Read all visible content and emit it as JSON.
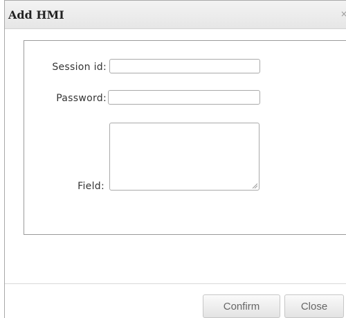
{
  "dialog": {
    "title": "Add HMI",
    "close_glyph": "×"
  },
  "form": {
    "session_label": "Session id:",
    "password_label": "Password:",
    "field_label": "Field:",
    "session_value": "",
    "password_value": "",
    "field_value": ""
  },
  "buttons": {
    "confirm": "Confirm",
    "close": "Close"
  }
}
